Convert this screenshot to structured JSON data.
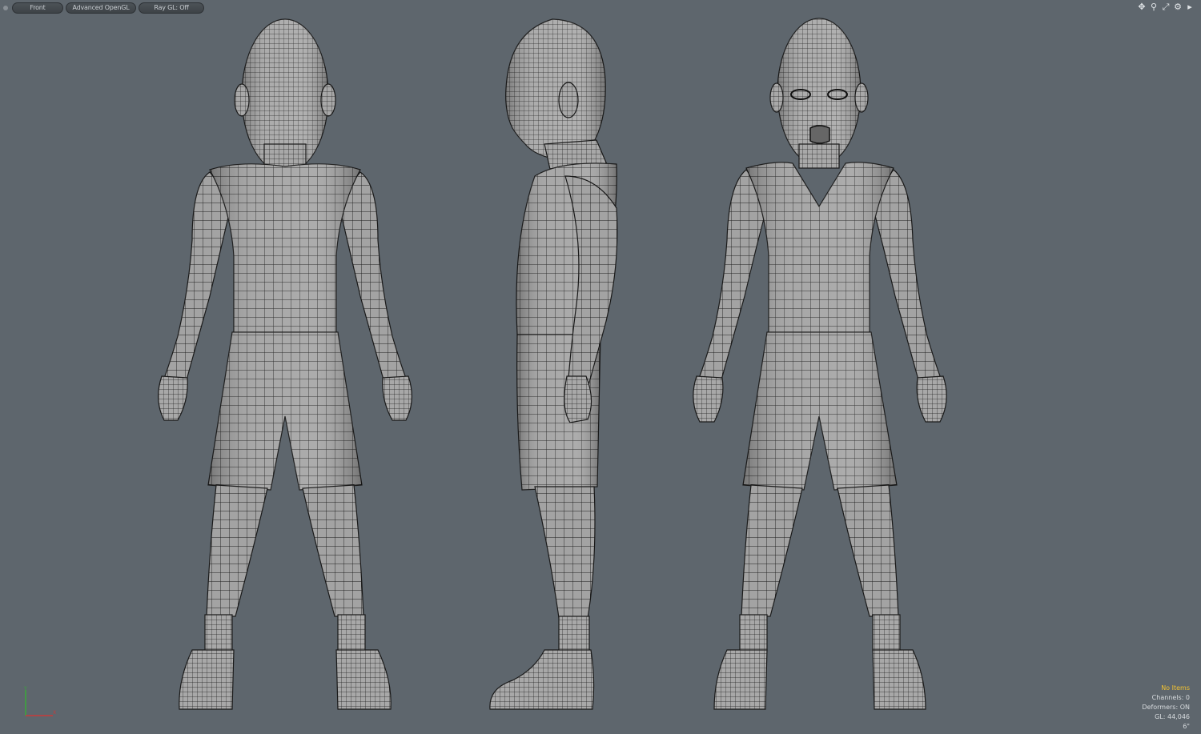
{
  "toolbar": {
    "view_label": "Front",
    "shading_label": "Advanced OpenGL",
    "raygl_label": "Ray GL: Off"
  },
  "tool_icons": [
    "move-view-icon",
    "zoom-icon",
    "maximize-icon",
    "settings-icon",
    "expand-arrow-icon"
  ],
  "info": {
    "items": "No Items",
    "channels": "Channels: 0",
    "deformers": "Deformers: ON",
    "gl": "GL: 44,046",
    "units": "6\""
  },
  "axis": {
    "y": "Y",
    "x": "X"
  },
  "colors": {
    "background": "#5e666d",
    "mesh_fill": "#9a9a9a",
    "wire": "#1e1e1e",
    "highlight": "#f2c230",
    "axis_y": "#3aa83a",
    "axis_x": "#c83a3a"
  }
}
